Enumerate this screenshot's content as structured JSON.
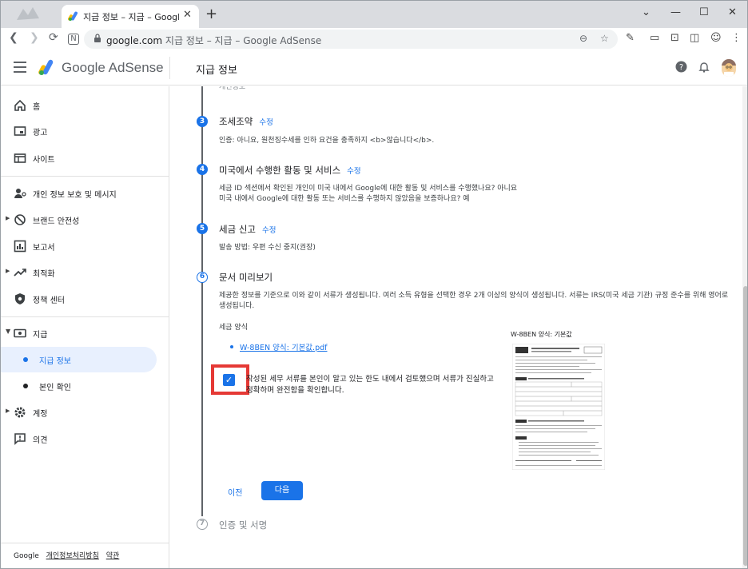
{
  "browser": {
    "tab_title": "지급 정보 – 지급 – Google AdSense",
    "url_host": "google.com",
    "url_rest": "지급 정보 – 지급 – Google AdSense"
  },
  "header": {
    "brand": "Google AdSense",
    "page_title": "지급 정보"
  },
  "sidebar": {
    "items": [
      {
        "label": "홈",
        "icon": "home-icon"
      },
      {
        "label": "광고",
        "icon": "ads-icon"
      },
      {
        "label": "사이트",
        "icon": "sites-icon"
      },
      {
        "label": "개인 정보 보호 및 메시지",
        "icon": "privacy-icon"
      },
      {
        "label": "브랜드 안전성",
        "icon": "block-icon"
      },
      {
        "label": "보고서",
        "icon": "reports-icon"
      },
      {
        "label": "최적화",
        "icon": "trend-icon"
      },
      {
        "label": "정책 센터",
        "icon": "policy-icon"
      },
      {
        "label": "지급",
        "icon": "payments-icon"
      },
      {
        "label": "지급 정보",
        "icon": "dot"
      },
      {
        "label": "본인 확인",
        "icon": "dot"
      },
      {
        "label": "계정",
        "icon": "gear-icon"
      },
      {
        "label": "의견",
        "icon": "feedback-icon"
      }
    ],
    "footer": {
      "brand": "Google",
      "privacy": "개인정보처리방침",
      "terms": "약관"
    }
  },
  "steps": {
    "top_partial": "개인정보",
    "step3": {
      "num": "3",
      "title": "조세조약",
      "edit": "수정",
      "desc": "인증: 아니요, 원천징수세를 인하 요건을 충족하지 <b>않습니다</b>."
    },
    "step4": {
      "num": "4",
      "title": "미국에서 수행한 활동 및 서비스",
      "edit": "수정",
      "desc1": "세금 ID 섹션에서 확인된 개인이 미국 내에서 Google에 대한 활동 및 서비스를 수행했나요? 아니요",
      "desc2": "미국 내에서 Google에 대한 활동 또는 서비스를 수행하지 않았음을 보증하나요? 예"
    },
    "step5": {
      "num": "5",
      "title": "세금 신고",
      "edit": "수정",
      "desc": "발송 방법: 우편 수신 중지(권장)"
    },
    "step6": {
      "num": "6",
      "title": "문서 미리보기",
      "desc": "제공한 정보를 기준으로 이와 같이 서류가 생성됩니다. 여러 소득 유형을 선택한 경우 2개 이상의 양식이 생성됩니다. 서류는 IRS(미국 세금 기관) 규정 준수를 위해 영어로 생성됩니다.",
      "form_label": "세금 양식",
      "form_link": "W-8BEN 양식: 기본값.pdf",
      "preview_label": "W-8BEN 양식: 기본값",
      "confirm": "작성된 세무 서류를 본인이 알고 있는 한도 내에서 검토했으며 서류가 진실하고 정확하며 완전함을 확인합니다.",
      "prev": "이전",
      "next": "다음"
    },
    "step7": {
      "num": "7",
      "title": "인증 및 서명"
    }
  }
}
